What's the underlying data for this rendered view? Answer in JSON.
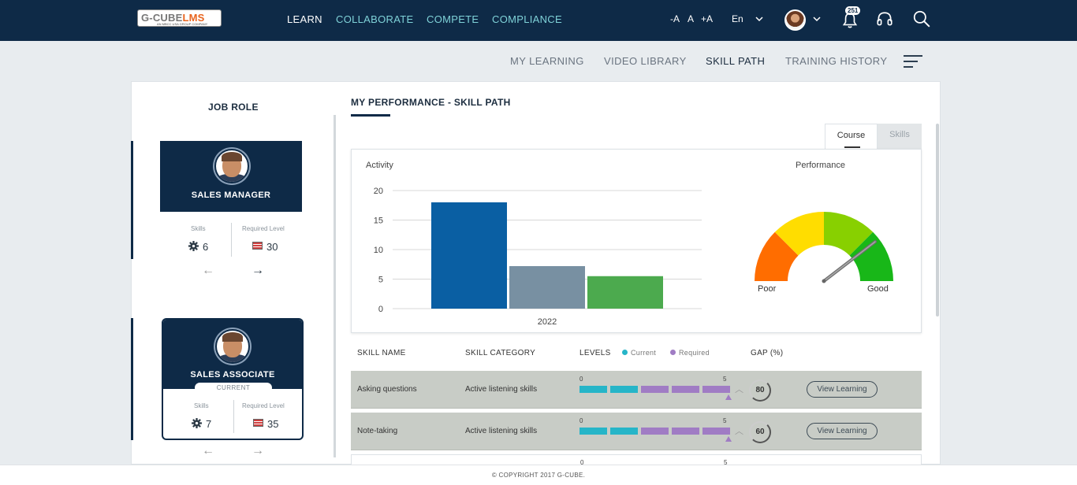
{
  "colors": {
    "header_bg": "#0e2a47",
    "nav_accent": "#7fd2d8",
    "current_level": "#26b5c8",
    "required_level": "#a07cc4",
    "bar_1": "#0a5fa3",
    "bar_2": "#7890a2",
    "bar_3": "#4caa4e",
    "row_bg": "#c8ccc6"
  },
  "header": {
    "logo_text_g": "G-CUBE",
    "logo_text_lms": "LMS",
    "logo_sub": "AN MBCC USA GROUP COMPANY",
    "nav": [
      "LEARN",
      "COLLABORATE",
      "COMPETE",
      "COMPLIANCE"
    ],
    "font_minus": "-A",
    "font_normal": "A",
    "font_plus": "+A",
    "language": "En",
    "notification_count": "251",
    "icons": [
      "bell-icon",
      "headset-icon",
      "search-icon",
      "chevron-down-icon"
    ]
  },
  "subnav": {
    "items": [
      "MY LEARNING",
      "VIDEO LIBRARY",
      "SKILL PATH",
      "TRAINING HISTORY"
    ],
    "active": "SKILL PATH"
  },
  "job_role": {
    "title": "JOB ROLE",
    "cards": [
      {
        "name": "SALES MANAGER",
        "skills_label": "Skills",
        "skills": "6",
        "required_label": "Required Level",
        "required": "30"
      },
      {
        "name": "SALES ASSOCIATE",
        "status": "CURRENT",
        "skills_label": "Skills",
        "skills": "7",
        "required_label": "Required Level",
        "required": "35"
      }
    ],
    "prev_arrow": "←",
    "next_arrow": "→"
  },
  "performance": {
    "title": "MY PERFORMANCE - SKILL PATH",
    "tabs": [
      "Course",
      "Skills"
    ],
    "active_tab": "Course",
    "activity_label": "Activity",
    "performance_label": "Performance",
    "gauge_poor": "Poor",
    "gauge_good": "Good",
    "gauge_value": 0.82
  },
  "chart_data": {
    "type": "bar",
    "title": "Activity",
    "categories": [
      "2022"
    ],
    "series": [
      {
        "values": [
          18
        ]
      },
      {
        "values": [
          7.2
        ]
      },
      {
        "values": [
          5.5
        ]
      }
    ],
    "ylim": [
      0,
      20
    ],
    "yticks": [
      0,
      5,
      10,
      15,
      20
    ],
    "xlabel": "",
    "ylabel": "",
    "grid": true
  },
  "table": {
    "headers": {
      "skill_name": "SKILL NAME",
      "skill_category": "SKILL CATEGORY",
      "levels": "LEVELS",
      "current": "Current",
      "required": "Required",
      "gap": "GAP (%)"
    },
    "rows": [
      {
        "name": "Asking questions",
        "category": "Active listening skills",
        "level_min": "0",
        "level_max": "5",
        "current": 2,
        "required": 5,
        "gap": "80",
        "action": "View Learning"
      },
      {
        "name": "Note-taking",
        "category": "Active listening skills",
        "level_min": "0",
        "level_max": "5",
        "current": 2,
        "required": 5,
        "gap": "60",
        "action": "View Learning"
      }
    ],
    "partial_row": {
      "level_min": "0",
      "level_max": "5"
    }
  },
  "footer": {
    "copyright": "© COPYRIGHT 2017 G-CUBE."
  }
}
